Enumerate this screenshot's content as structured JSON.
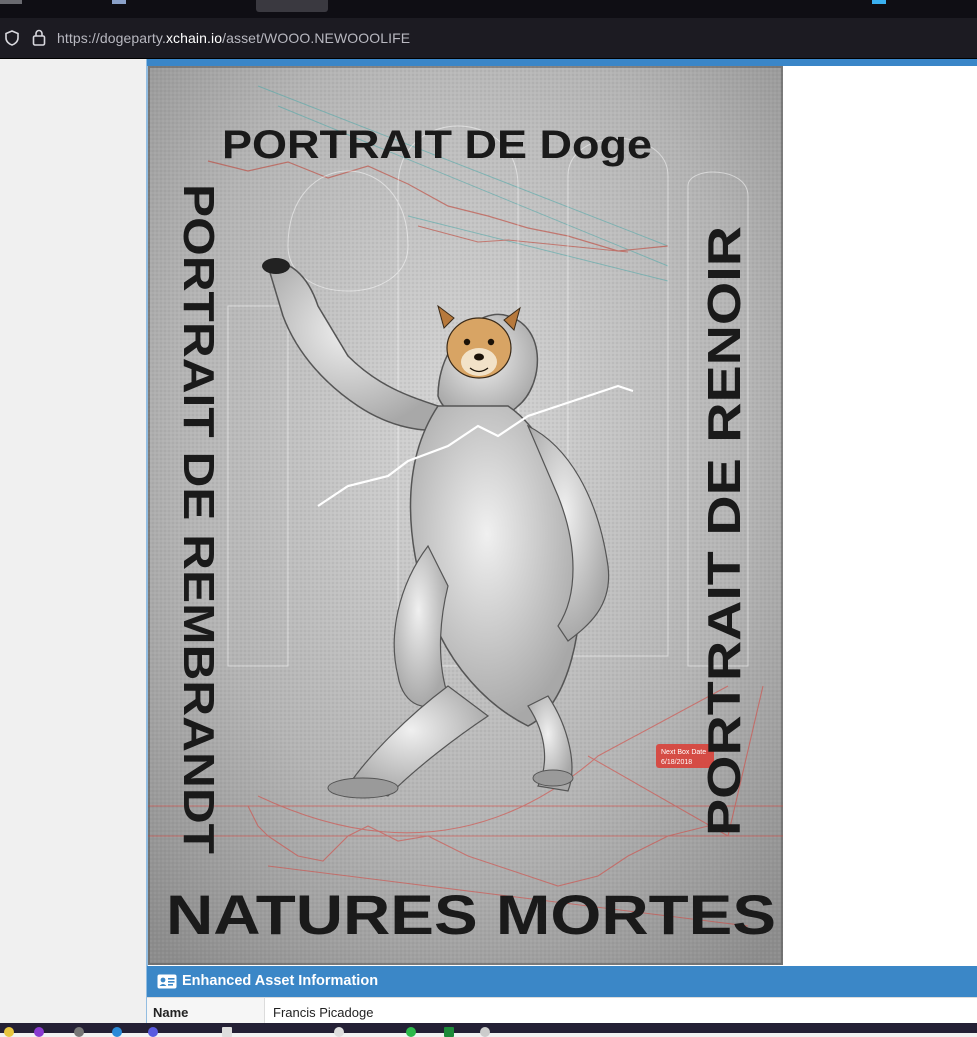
{
  "browser": {
    "url_prefix": "https://dogeparty.",
    "url_host": "xchain.io",
    "url_path": "/asset/WOOO.NEWOOOLIFE"
  },
  "artwork": {
    "title": "PORTRAIT DE Doge",
    "left_text": "PORTRAIT DE REMBRANDT",
    "right_text": "PORTRAIT DE RENOIR",
    "bottom_text": "NATURES MORTES",
    "tooltip_line1": "Next Box Date",
    "tooltip_line2": "6/18/2018"
  },
  "panel": {
    "title": "Enhanced Asset Information",
    "rows": [
      {
        "label": "Name",
        "value": "Francis Picadoge"
      }
    ]
  },
  "colors": {
    "accent": "#3b87c7",
    "chrome": "#1c1b22"
  }
}
